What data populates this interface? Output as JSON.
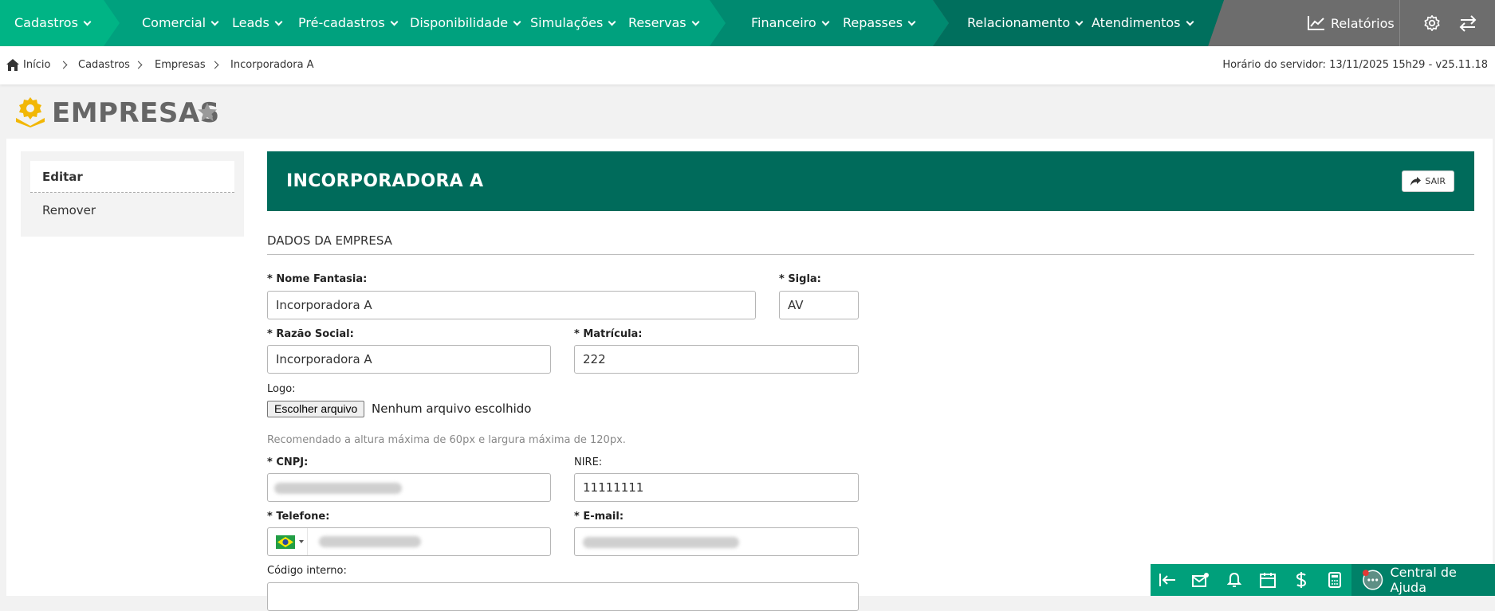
{
  "nav": {
    "items": [
      {
        "label": "Cadastros"
      },
      {
        "label": "Comercial"
      },
      {
        "label": "Leads"
      },
      {
        "label": "Pré-cadastros"
      },
      {
        "label": "Disponibilidade"
      },
      {
        "label": "Simulações"
      },
      {
        "label": "Reservas"
      },
      {
        "label": "Financeiro"
      },
      {
        "label": "Repasses"
      },
      {
        "label": "Relacionamento"
      },
      {
        "label": "Atendimentos"
      }
    ],
    "reports_label": "Relatórios",
    "colors": {
      "seg1": "#00b485",
      "seg2": "#00a17e",
      "seg3": "#008a70",
      "seg4": "#006f5d",
      "rest": "#6d6d6d"
    }
  },
  "breadcrumb": {
    "items": [
      "Início",
      "Cadastros",
      "Empresas",
      "Incorporadora A"
    ],
    "server_time": "Horário do servidor: 13/11/2025 15h29 - v25.11.18"
  },
  "page": {
    "title": "EMPRESAS"
  },
  "sidebar": {
    "items": [
      {
        "label": "Editar"
      },
      {
        "label": "Remover"
      }
    ]
  },
  "header": {
    "title": "INCORPORADORA A",
    "exit_label": "SAIR"
  },
  "form": {
    "section_title": "DADOS DA EMPRESA",
    "nome_fantasia": {
      "label": "* Nome Fantasia:",
      "value": "Incorporadora A"
    },
    "sigla": {
      "label": "* Sigla:",
      "value": "AV"
    },
    "razao_social": {
      "label": "* Razão Social:",
      "value": "Incorporadora A"
    },
    "matricula": {
      "label": "* Matrícula:",
      "value": "222"
    },
    "logo": {
      "label": "Logo:",
      "button_label": "Escolher arquivo",
      "file_status": "Nenhum arquivo escolhido",
      "hint": "Recomendado a altura máxima de 60px e largura máxima de 120px."
    },
    "cnpj": {
      "label": "* CNPJ:"
    },
    "nire": {
      "label": "NIRE:",
      "value": "11111111"
    },
    "telefone": {
      "label": "* Telefone:"
    },
    "email": {
      "label": "* E-mail:"
    },
    "codigo_interno": {
      "label": "Código interno:",
      "value": ""
    }
  },
  "bottom_bar": {
    "icons": [
      "collapse-left-icon",
      "mail-icon",
      "bell-icon",
      "calendar-icon",
      "dollar-icon",
      "calculator-icon"
    ],
    "help_label": "Central de Ajuda"
  }
}
